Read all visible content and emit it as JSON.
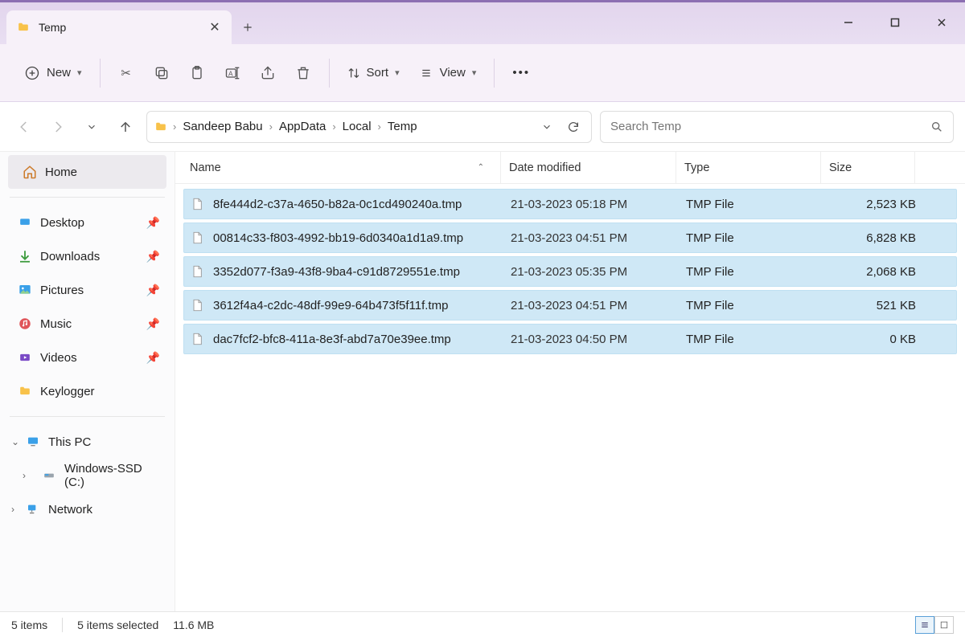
{
  "window": {
    "tab_title": "Temp",
    "minimize": "—",
    "maximize": "▢",
    "close": "✕"
  },
  "toolbar": {
    "new": "New",
    "sort": "Sort",
    "view": "View",
    "overflow": "•••"
  },
  "address": {
    "breadcrumbs": [
      "Sandeep Babu",
      "AppData",
      "Local",
      "Temp"
    ]
  },
  "search": {
    "placeholder": "Search Temp"
  },
  "sidebar": {
    "home": "Home",
    "quick": [
      {
        "label": "Desktop"
      },
      {
        "label": "Downloads"
      },
      {
        "label": "Pictures"
      },
      {
        "label": "Music"
      },
      {
        "label": "Videos"
      },
      {
        "label": "Keylogger"
      }
    ],
    "thispc": "This PC",
    "drive": "Windows-SSD (C:)",
    "network": "Network"
  },
  "columns": {
    "name": "Name",
    "date": "Date modified",
    "type": "Type",
    "size": "Size"
  },
  "files": [
    {
      "name": "8fe444d2-c37a-4650-b82a-0c1cd490240a.tmp",
      "date": "21-03-2023 05:18 PM",
      "type": "TMP File",
      "size": "2,523 KB"
    },
    {
      "name": "00814c33-f803-4992-bb19-6d0340a1d1a9.tmp",
      "date": "21-03-2023 04:51 PM",
      "type": "TMP File",
      "size": "6,828 KB"
    },
    {
      "name": "3352d077-f3a9-43f8-9ba4-c91d8729551e.tmp",
      "date": "21-03-2023 05:35 PM",
      "type": "TMP File",
      "size": "2,068 KB"
    },
    {
      "name": "3612f4a4-c2dc-48df-99e9-64b473f5f11f.tmp",
      "date": "21-03-2023 04:51 PM",
      "type": "TMP File",
      "size": "521 KB"
    },
    {
      "name": "dac7fcf2-bfc8-411a-8e3f-abd7a70e39ee.tmp",
      "date": "21-03-2023 04:50 PM",
      "type": "TMP File",
      "size": "0 KB"
    }
  ],
  "status": {
    "count": "5 items",
    "selected": "5 items selected",
    "size": "11.6 MB"
  }
}
